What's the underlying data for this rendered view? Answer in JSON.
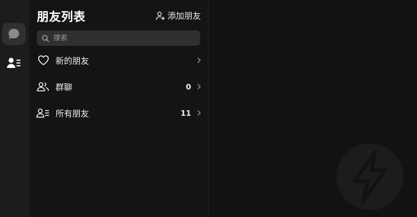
{
  "rail": {
    "items": [
      {
        "icon": "chat-bubble-icon",
        "active": true
      },
      {
        "icon": "contacts-icon",
        "active": false
      }
    ]
  },
  "panel": {
    "title": "朋友列表",
    "add_friend_label": "添加朋友",
    "search_placeholder": "搜索",
    "rows": [
      {
        "label": "新的朋友",
        "count": "",
        "icon": "heart-icon"
      },
      {
        "label": "群聊",
        "count": "0",
        "icon": "group-icon"
      },
      {
        "label": "所有朋友",
        "count": "11",
        "icon": "contacts-list-icon"
      }
    ]
  },
  "colors": {
    "background": "#121212",
    "rail": "#1c1c1c",
    "panel": "#141414",
    "search": "#303030",
    "text": "#ffffff"
  }
}
